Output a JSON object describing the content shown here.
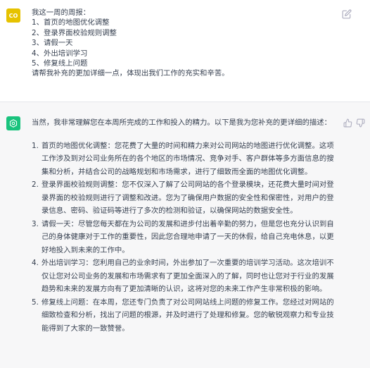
{
  "user": {
    "avatar_text": "CO",
    "avatar_color": "#e6c200",
    "lines": [
      "我这一周的周报：",
      "1、首页的地图优化调整",
      "2、登录界面校验规则调整",
      "3、请假一天",
      "4、外出培训学习",
      "5、修复线上问题",
      "请帮我补充的更加详细一点，体现出我们工作的充实和辛苦。"
    ],
    "edit_icon": "pencil-edit-icon"
  },
  "assistant": {
    "avatar_color": "#19c37d",
    "avatar_icon": "openai-logo-icon",
    "intro": "当然，我非常理解您在本周所完成的工作和投入的精力。以下是我为您补充的更详细的描述：",
    "items": [
      {
        "num": "1.",
        "text": "首页的地图优化调整：您花费了大量的时间和精力来对公司网站的地图进行优化调整。这项工作涉及到对公司业务所在的各个地区的市场情况、竞争对手、客户群体等多方面信息的搜集和分析，并结合公司的战略规划和市场需求，进行了细致而全面的地图优化调整。"
      },
      {
        "num": "2.",
        "text": "登录界面校验规则调整：您不仅深入了解了公司网站的各个登录模块，还花费大量时间对登录界面的校验规则进行了调整和改进。您为了确保用户数据的安全性和保密性，对用户的登录信息、密码、验证码等进行了多次的检测和验证，以确保网站的数据安全性。"
      },
      {
        "num": "3.",
        "text": "请假一天：尽管您每天都在为公司的发展和进步付出着辛勤的努力，但是您也充分认识到自己的身体健康对于工作的重要性，因此您合理地申请了一天的休假，给自己充电休息，以更好地投入到未来的工作中。"
      },
      {
        "num": "4.",
        "text": "外出培训学习：您利用自己的业余时间，外出参加了一次重要的培训学习活动。这次培训不仅让您对公司业务的发展和市场需求有了更加全面深入的了解，同时也让您对于行业的发展趋势和未来的发展方向有了更加清晰的认识，这将对您的未来工作产生非常积极的影响。"
      },
      {
        "num": "5.",
        "text": "修复线上问题：在本周，您还专门负责了对公司网站线上问题的修复工作。您经过对网站的细致检查和分析，找出了问题的根源，并及时进行了处理和修复。您的敏锐观察力和专业技能得到了大家的一致赞誉。"
      }
    ],
    "thumb_up_icon": "thumbs-up-icon",
    "thumb_down_icon": "thumbs-down-icon"
  }
}
